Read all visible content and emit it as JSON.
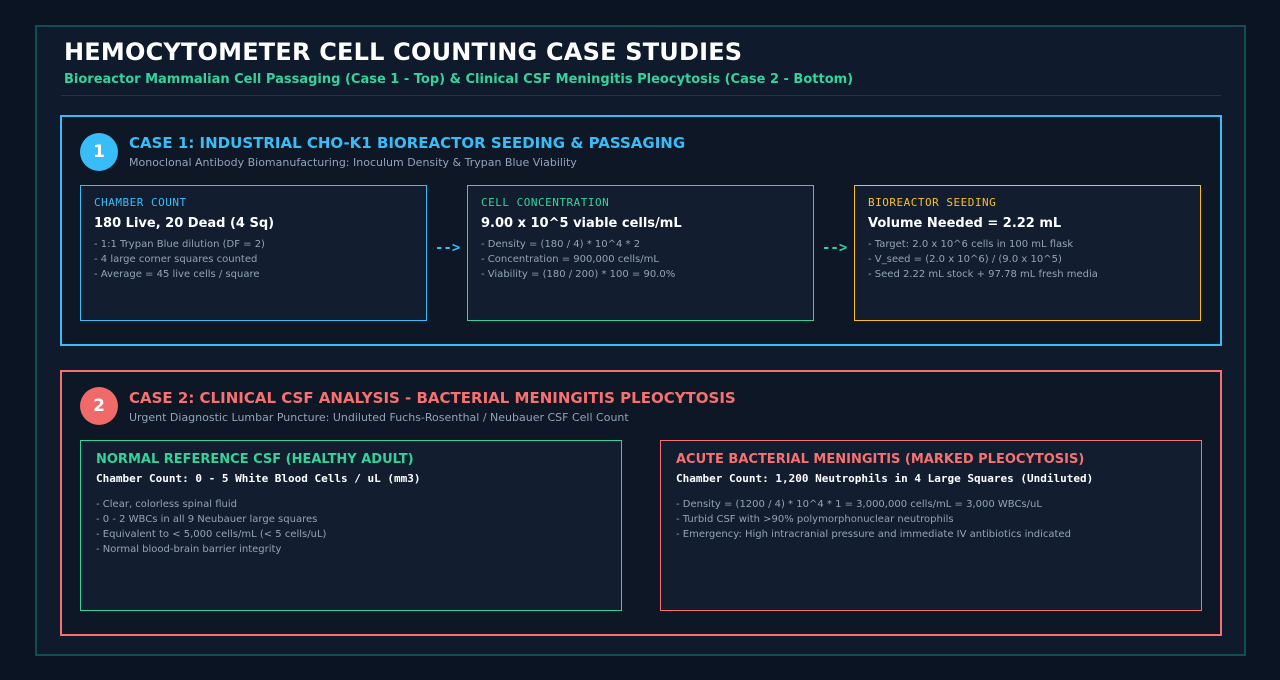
{
  "header": {
    "title": "HEMOCYTOMETER CELL COUNTING CASE STUDIES",
    "subtitle": "Bioreactor Mammalian Cell Passaging (Case 1 - Top) & Clinical CSF Meningitis Pleocytosis (Case 2 - Bottom)"
  },
  "case1": {
    "number": "1",
    "title": "CASE 1: INDUSTRIAL CHO-K1 BIOREACTOR SEEDING & PASSAGING",
    "subtitle": "Monoclonal Antibody Biomanufacturing: Inoculum Density & Trypan Blue Viability",
    "chamber": {
      "label": "CHAMBER COUNT",
      "main": "180 Live, 20 Dead (4 Sq)",
      "lines": [
        "- 1:1 Trypan Blue dilution (DF = 2)",
        "- 4 large corner squares counted",
        "- Average = 45 live cells / square"
      ]
    },
    "concentration": {
      "label": "CELL CONCENTRATION",
      "main": "9.00 x 10^5 viable cells/mL",
      "lines": [
        "- Density = (180 / 4) * 10^4 * 2",
        "- Concentration = 900,000 cells/mL",
        "- Viability = (180 / 200) * 100 = 90.0%"
      ]
    },
    "seeding": {
      "label": "BIOREACTOR SEEDING",
      "main": "Volume Needed = 2.22 mL",
      "lines": [
        "- Target: 2.0 x 10^6 cells in 100 mL flask",
        "- V_seed = (2.0 x 10^6) / (9.0 x 10^5)",
        "- Seed 2.22 mL stock + 97.78 mL fresh media"
      ]
    },
    "arrow": "-->"
  },
  "case2": {
    "number": "2",
    "title": "CASE 2: CLINICAL CSF ANALYSIS - BACTERIAL MENINGITIS PLEOCYTOSIS",
    "subtitle": "Urgent Diagnostic Lumbar Puncture: Undiluted Fuchs-Rosenthal / Neubauer CSF Cell Count",
    "normal": {
      "title": "NORMAL REFERENCE CSF (HEALTHY ADULT)",
      "main": "Chamber Count: 0 - 5 White Blood Cells / uL (mm3)",
      "lines": [
        "- Clear, colorless spinal fluid",
        "- 0 - 2 WBCs in all 9 Neubauer large squares",
        "- Equivalent to < 5,000 cells/mL (< 5 cells/uL)",
        "- Normal blood-brain barrier integrity"
      ]
    },
    "acute": {
      "title": "ACUTE BACTERIAL MENINGITIS (MARKED PLEOCYTOSIS)",
      "main": "Chamber Count: 1,200 Neutrophils in 4 Large Squares (Undiluted)",
      "lines": [
        "- Density = (1200 / 4) * 10^4 * 1 = 3,000,000 cells/mL = 3,000 WBCs/uL",
        "- Turbid CSF with >90% polymorphonuclear neutrophils",
        "- Emergency: High intracranial pressure and immediate IV antibiotics indicated"
      ]
    }
  },
  "colors": {
    "case1_accent": "#38bdf8",
    "case2_accent": "#f87171",
    "green_accent": "#34d399",
    "amber_accent": "#fbbf24",
    "background": "#0b1422"
  }
}
